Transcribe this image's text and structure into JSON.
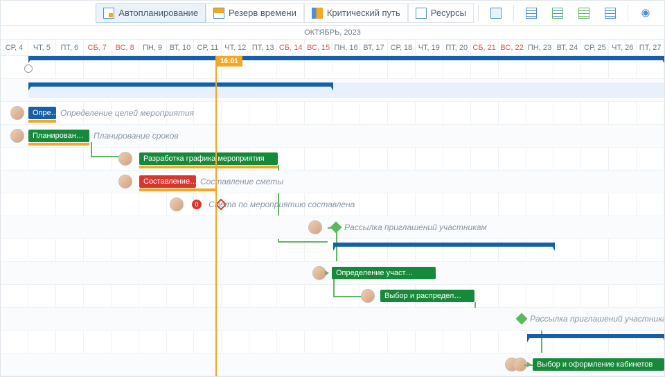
{
  "toolbar": {
    "auto": "Автопланирование",
    "slack": "Резерв времени",
    "critical": "Критический путь",
    "resources": "Ресурсы"
  },
  "timeline": {
    "month": "ОКТЯБРЬ, 2023",
    "now": "16:01",
    "days": [
      {
        "l": "СР, 4",
        "w": false
      },
      {
        "l": "ЧТ, 5",
        "w": false
      },
      {
        "l": "ПТ, 6",
        "w": false
      },
      {
        "l": "СБ, 7",
        "w": true
      },
      {
        "l": "ВС, 8",
        "w": true
      },
      {
        "l": "ПН, 9",
        "w": false
      },
      {
        "l": "ВТ, 10",
        "w": false
      },
      {
        "l": "СР, 11",
        "w": false
      },
      {
        "l": "ЧТ, 12",
        "w": false
      },
      {
        "l": "ПТ, 13",
        "w": false
      },
      {
        "l": "СБ, 14",
        "w": true
      },
      {
        "l": "ВС, 15",
        "w": true
      },
      {
        "l": "ПН, 16",
        "w": false
      },
      {
        "l": "ВТ, 17",
        "w": false
      },
      {
        "l": "СР, 18",
        "w": false
      },
      {
        "l": "ЧТ, 19",
        "w": false
      },
      {
        "l": "ПТ, 20",
        "w": false
      },
      {
        "l": "СБ, 21",
        "w": true
      },
      {
        "l": "ВС, 22",
        "w": true
      },
      {
        "l": "ПН, 23",
        "w": false
      },
      {
        "l": "ВТ, 24",
        "w": false
      },
      {
        "l": "СР, 25",
        "w": false
      },
      {
        "l": "ЧТ, 26",
        "w": false
      },
      {
        "l": "ПТ, 27",
        "w": false
      }
    ]
  },
  "tasks": {
    "t1": {
      "bar": "Опре…",
      "label": "Определение целей мероприятия"
    },
    "t2": {
      "bar": "Планирован…",
      "label": "Планирование сроков"
    },
    "t3": {
      "bar": "Разработка графика мероприятия"
    },
    "t4": {
      "bar": "Составление…",
      "label": "Составление сметы"
    },
    "t5": {
      "label": "Смета по мероприятию составлена",
      "warn": "0"
    },
    "t6": {
      "label": "Рассылка приглашений участникам"
    },
    "t7": {
      "bar": "Определение участ…"
    },
    "t8": {
      "bar": "Выбор и распредел…"
    },
    "t9": {
      "label": "Рассылка приглашений участникам"
    },
    "t10": {
      "bar": "Выбор и оформление кабинетов"
    }
  }
}
